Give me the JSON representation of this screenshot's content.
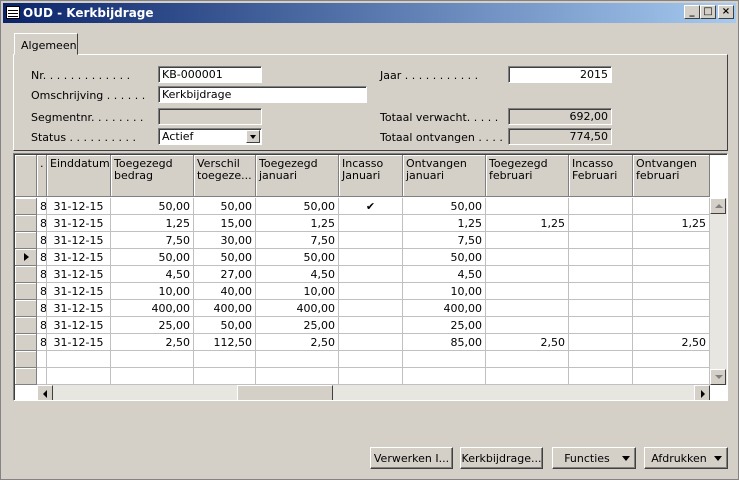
{
  "window": {
    "title": "OUD - Kerkbijdrage",
    "min_label": "_",
    "max_label": "□",
    "close_label": "×"
  },
  "tabs": [
    {
      "label": "Algemeen"
    }
  ],
  "form": {
    "nr_label": "Nr. . . . . . . . . . . . .",
    "nr_value": "KB-000001",
    "omschrijving_label": "Omschrijving . . . . . .",
    "omschrijving_value": "Kerkbijdrage",
    "segment_label": "Segmentnr. . . . . . . .",
    "segment_value": "",
    "status_label": "Status . . . . . . . . . .",
    "status_value": "Actief",
    "jaar_label": "Jaar . . . . . . . . . . .",
    "jaar_value": "2015",
    "totaal_verwacht_label": "Totaal verwacht. . . . .",
    "totaal_verwacht_value": "692,00",
    "totaal_ontvangen_label": "Totaal ontvangen . . . .",
    "totaal_ontvangen_value": "774,50"
  },
  "table": {
    "columns": [
      ".",
      "Einddatum",
      "Toegezegd bedrag",
      "Verschil toegeze...",
      "Toegezegd januari",
      "Incasso Januari",
      "Ontvangen januari",
      "Toegezegd februari",
      "Incasso Februari",
      "Ontvangen februari"
    ],
    "rows": [
      [
        "8",
        "31-12-15",
        "50,00",
        "50,00",
        "50,00",
        "✔",
        "50,00",
        "",
        "",
        ""
      ],
      [
        "8",
        "31-12-15",
        "1,25",
        "15,00",
        "1,25",
        "",
        "1,25",
        "1,25",
        "",
        "1,25"
      ],
      [
        "8",
        "31-12-15",
        "7,50",
        "30,00",
        "7,50",
        "",
        "7,50",
        "",
        "",
        ""
      ],
      [
        "8",
        "31-12-15",
        "50,00",
        "50,00",
        "50,00",
        "",
        "50,00",
        "",
        "",
        ""
      ],
      [
        "8",
        "31-12-15",
        "4,50",
        "27,00",
        "4,50",
        "",
        "4,50",
        "",
        "",
        ""
      ],
      [
        "8",
        "31-12-15",
        "10,00",
        "40,00",
        "10,00",
        "",
        "10,00",
        "",
        "",
        ""
      ],
      [
        "8",
        "31-12-15",
        "400,00",
        "400,00",
        "400,00",
        "",
        "400,00",
        "",
        "",
        ""
      ],
      [
        "8",
        "31-12-15",
        "25,00",
        "50,00",
        "25,00",
        "",
        "25,00",
        "",
        "",
        ""
      ],
      [
        "8",
        "31-12-15",
        "2,50",
        "112,50",
        "2,50",
        "",
        "85,00",
        "2,50",
        "",
        "2,50"
      ]
    ],
    "current_row": 3
  },
  "buttons": {
    "verwerken": "Verwerken I...",
    "kerkbijdrage": "Kerkbijdrage...",
    "functies": "Functies",
    "afdrukken": "Afdrukken"
  }
}
